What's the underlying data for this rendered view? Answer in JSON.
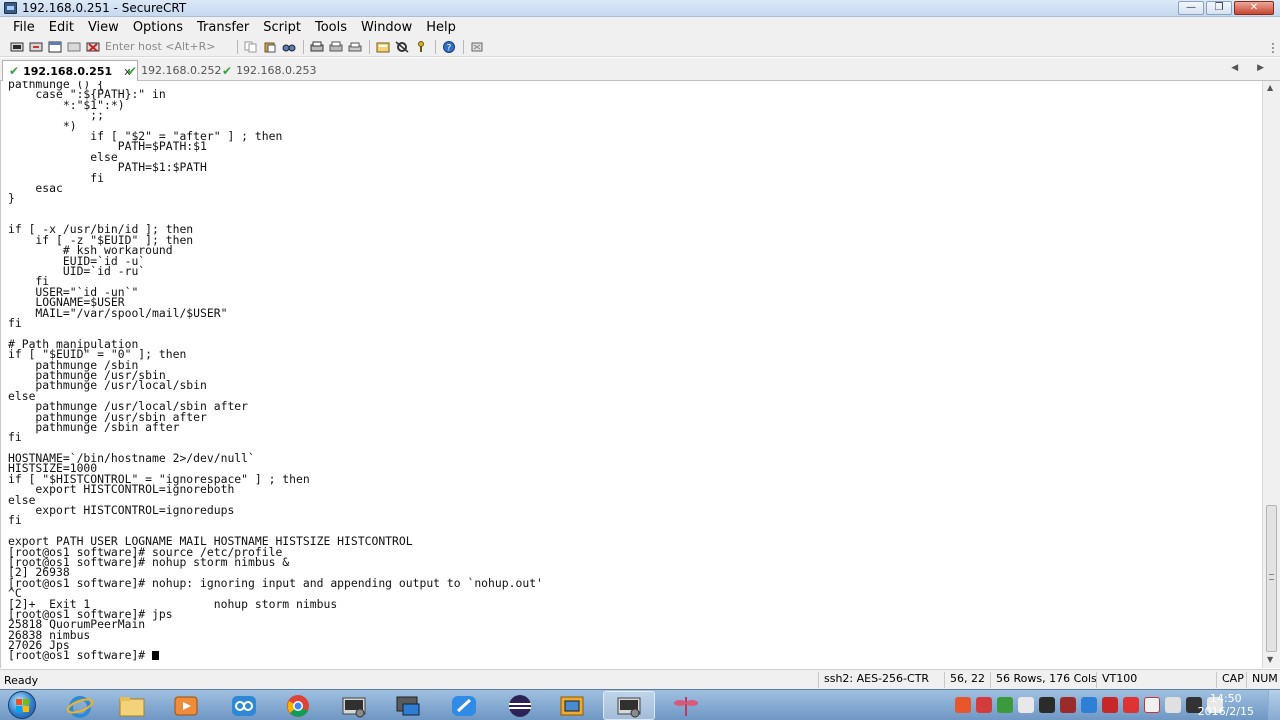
{
  "window": {
    "title": "192.168.0.251 - SecureCRT",
    "min": "—",
    "max": "❐",
    "close": "✕"
  },
  "menu": [
    "File",
    "Edit",
    "View",
    "Options",
    "Transfer",
    "Script",
    "Tools",
    "Window",
    "Help"
  ],
  "toolbar": {
    "host_placeholder": "Enter host <Alt+R>"
  },
  "tabs": [
    {
      "label": "192.168.0.251",
      "active": true,
      "close": "x"
    },
    {
      "label": "192.168.0.252",
      "active": false
    },
    {
      "label": "192.168.0.253",
      "active": false
    }
  ],
  "tab_nav": "◀ ▶",
  "terminal": {
    "lines": [
      "pathmunge () {",
      "    case \":${PATH}:\" in",
      "        *:\"$1\":*)",
      "            ;;",
      "        *)",
      "            if [ \"$2\" = \"after\" ] ; then",
      "                PATH=$PATH:$1",
      "            else",
      "                PATH=$1:$PATH",
      "            fi",
      "    esac",
      "}",
      "",
      "",
      "if [ -x /usr/bin/id ]; then",
      "    if [ -z \"$EUID\" ]; then",
      "        # ksh workaround",
      "        EUID=`id -u`",
      "        UID=`id -ru`",
      "    fi",
      "    USER=\"`id -un`\"",
      "    LOGNAME=$USER",
      "    MAIL=\"/var/spool/mail/$USER\"",
      "fi",
      "",
      "# Path manipulation",
      "if [ \"$EUID\" = \"0\" ]; then",
      "    pathmunge /sbin",
      "    pathmunge /usr/sbin",
      "    pathmunge /usr/local/sbin",
      "else",
      "    pathmunge /usr/local/sbin after",
      "    pathmunge /usr/sbin after",
      "    pathmunge /sbin after",
      "fi",
      "",
      "HOSTNAME=`/bin/hostname 2>/dev/null`",
      "HISTSIZE=1000",
      "if [ \"$HISTCONTROL\" = \"ignorespace\" ] ; then",
      "    export HISTCONTROL=ignoreboth",
      "else",
      "    export HISTCONTROL=ignoredups",
      "fi",
      "",
      "export PATH USER LOGNAME MAIL HOSTNAME HISTSIZE HISTCONTROL",
      "[root@os1 software]# source /etc/profile",
      "[root@os1 software]# nohup storm nimbus &",
      "[2] 26938",
      "[root@os1 software]# nohup: ignoring input and appending output to `nohup.out'",
      "^C",
      "[2]+  Exit 1                  nohup storm nimbus",
      "[root@os1 software]# jps",
      "25818 QuorumPeerMain",
      "26838 nimbus",
      "27026 Jps"
    ],
    "prompt": "[root@os1 software]# "
  },
  "status": {
    "ready": "Ready",
    "cipher": "ssh2: AES-256-CTR",
    "position": "56,  22",
    "dimensions": "56 Rows, 176 Cols",
    "emulation": "VT100",
    "caps": "CAP",
    "num": "NUM"
  },
  "taskbar": {
    "time": "14:50",
    "date": "2016/2/15"
  }
}
